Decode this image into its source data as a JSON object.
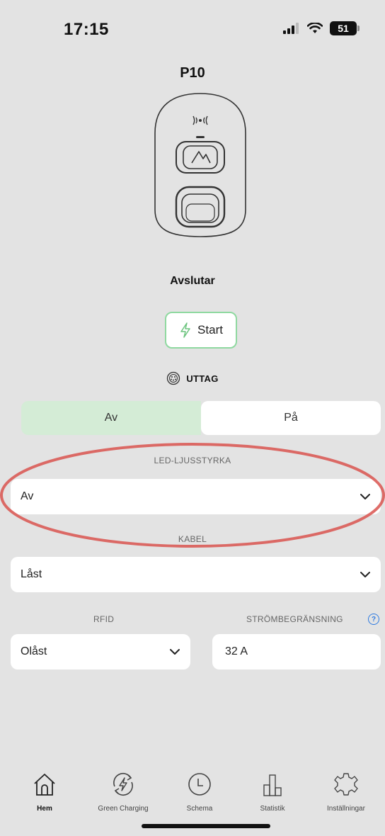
{
  "status_bar": {
    "time": "17:15",
    "battery": "51",
    "icons": [
      "signal-icon",
      "wifi-icon",
      "battery-icon"
    ]
  },
  "device": {
    "name": "P10",
    "state": "Avslutar"
  },
  "actions": {
    "start_label": "Start"
  },
  "outlet": {
    "label": "UTTAG",
    "toggle_off": "Av",
    "toggle_on": "På",
    "selected": "Av"
  },
  "led": {
    "label": "LED-LJUSSTYRKA",
    "value": "Av"
  },
  "cable": {
    "label": "KABEL",
    "value": "Låst"
  },
  "rfid": {
    "label": "RFID",
    "value": "Olåst"
  },
  "current_limit": {
    "label": "STRÖMBEGRÄNSNING",
    "value": "32 A"
  },
  "tabs": [
    {
      "label": "Hem",
      "icon": "home-icon",
      "active": true
    },
    {
      "label": "Green Charging",
      "icon": "green-charging-icon",
      "active": false
    },
    {
      "label": "Schema",
      "icon": "clock-icon",
      "active": false
    },
    {
      "label": "Statistik",
      "icon": "bar-chart-icon",
      "active": false
    },
    {
      "label": "Inställningar",
      "icon": "gear-icon",
      "active": false
    }
  ],
  "colors": {
    "background": "#e3e3e3",
    "accent_green": "#8fd9a0",
    "toggle_selected": "#d4ecd6",
    "annotation_red": "#d9534f",
    "help_blue": "#2f7be0"
  }
}
